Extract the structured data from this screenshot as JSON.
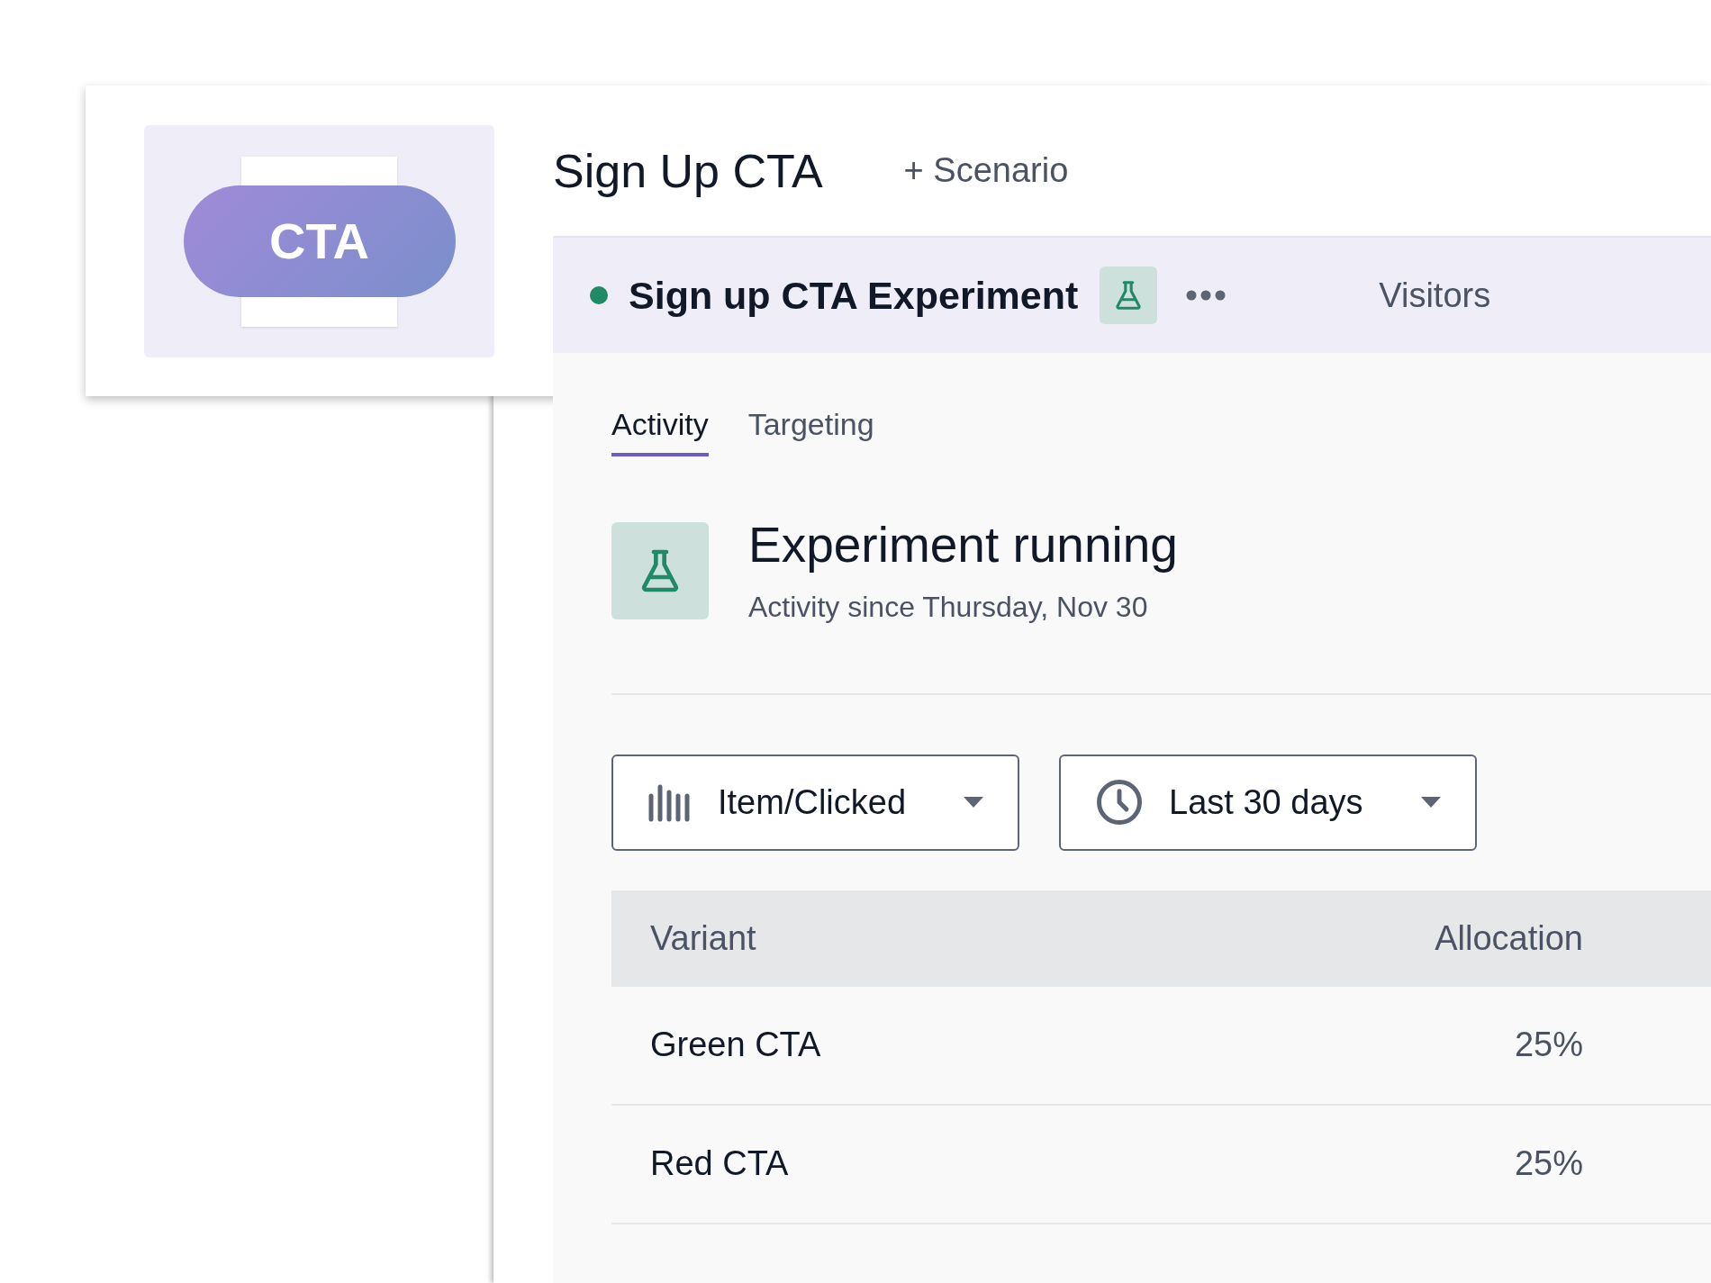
{
  "preview": {
    "label": "CTA"
  },
  "header": {
    "title": "Sign Up CTA",
    "add_button": "+ Scenario"
  },
  "experiment": {
    "title": "Sign up CTA Experiment",
    "color": "#1f8a65",
    "column": "Visitors"
  },
  "tabs": [
    {
      "label": "Activity",
      "selected": true
    },
    {
      "label": "Targeting",
      "selected": false
    }
  ],
  "status": {
    "title": "Experiment running",
    "subtitle": "Activity since Thursday, Nov 30"
  },
  "filters": [
    {
      "kind": "metric",
      "value": "Item/Clicked"
    },
    {
      "kind": "period",
      "value": "Last 30 days"
    }
  ],
  "table": {
    "columns": [
      "Variant",
      "Allocation"
    ],
    "rows": [
      {
        "variant": "Green CTA",
        "allocation": "25%"
      },
      {
        "variant": "Red CTA",
        "allocation": "25%"
      }
    ]
  }
}
